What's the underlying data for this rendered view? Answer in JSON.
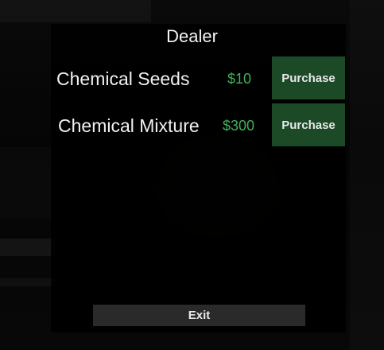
{
  "dealer": {
    "title": "Dealer",
    "items": [
      {
        "name": "Chemical Seeds",
        "price": "$10",
        "button_label": "Purchase"
      },
      {
        "name": "Chemical Mixture",
        "price": "$300",
        "button_label": "Purchase"
      }
    ],
    "exit_label": "Exit"
  },
  "colors": {
    "price_text": "#3fb05a",
    "purchase_button_bg": "#1c4a26",
    "exit_button_bg": "#2a2a2a",
    "panel_bg": "#000000"
  }
}
